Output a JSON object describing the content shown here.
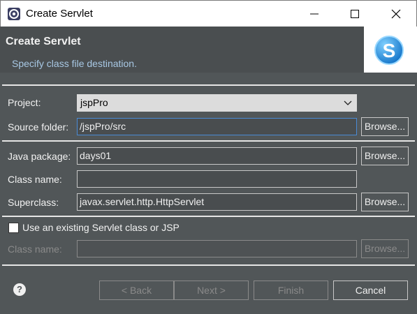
{
  "window": {
    "title": "Create Servlet",
    "icons": {
      "app": "eclipse-app-icon",
      "minimize": "minimize-icon",
      "maximize": "maximize-icon",
      "close": "close-icon"
    }
  },
  "header": {
    "title": "Create Servlet",
    "subtitle": "Specify class file destination.",
    "logo_letter": "S",
    "logo_icon": "servlet-logo-icon"
  },
  "form": {
    "project": {
      "label": "Project:",
      "value": "jspPro"
    },
    "source_folder": {
      "label": "Source folder:",
      "value": "/jspPro/src",
      "browse": "Browse..."
    },
    "java_package": {
      "label": "Java package:",
      "value": "days01",
      "browse": "Browse..."
    },
    "class_name": {
      "label": "Class name:",
      "value": ""
    },
    "superclass": {
      "label": "Superclass:",
      "value": "javax.servlet.http.HttpServlet",
      "browse": "Browse..."
    },
    "existing": {
      "label": "Use an existing Servlet class or JSP",
      "checked": false
    },
    "existing_class_name": {
      "label": "Class name:",
      "value": "",
      "browse": "Browse..."
    }
  },
  "footer": {
    "help": "?",
    "back": "< Back",
    "next": "Next >",
    "finish": "Finish",
    "cancel": "Cancel"
  },
  "colors": {
    "accent": "#4a8bd6",
    "logo_blue": "#1e90e0",
    "background": "#515658"
  }
}
